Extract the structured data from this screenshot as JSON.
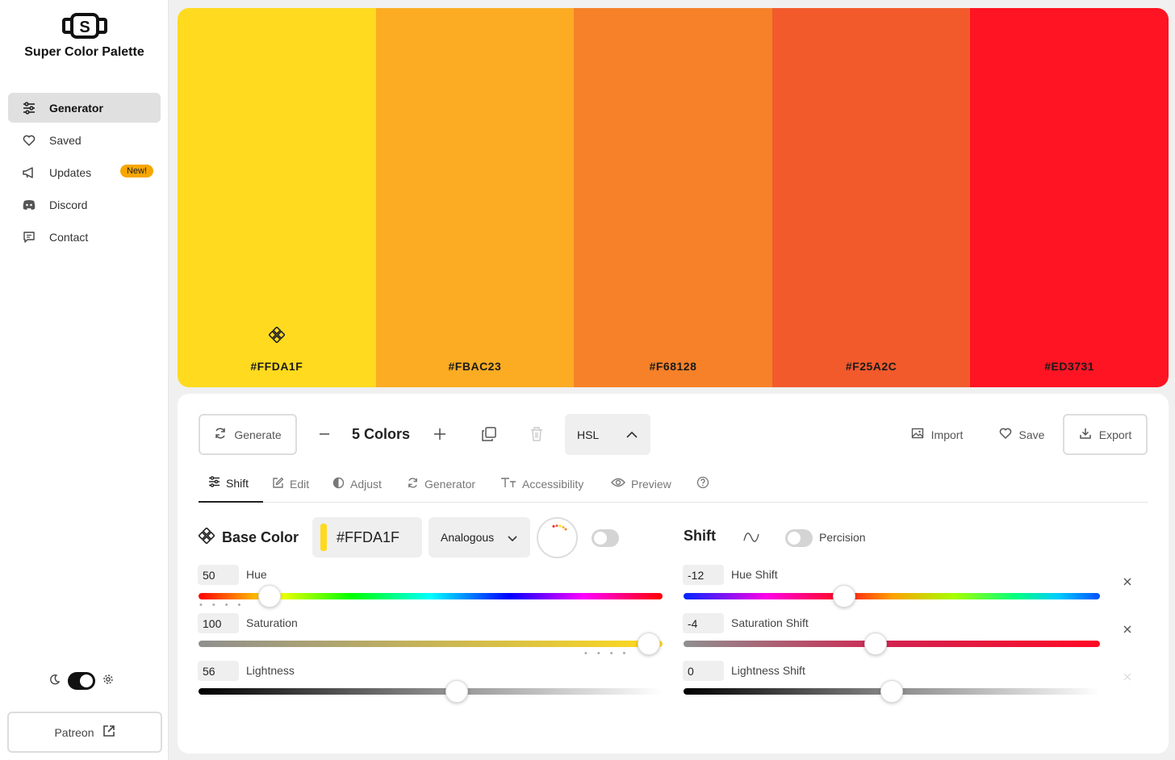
{
  "app": {
    "name": "Super Color Palette"
  },
  "sidebar": {
    "items": [
      {
        "label": "Generator",
        "icon": "sliders-icon",
        "active": true
      },
      {
        "label": "Saved",
        "icon": "heart-icon"
      },
      {
        "label": "Updates",
        "icon": "megaphone-icon",
        "badge": "New!"
      },
      {
        "label": "Discord",
        "icon": "discord-icon"
      },
      {
        "label": "Contact",
        "icon": "message-icon"
      }
    ],
    "patreon_label": "Patreon"
  },
  "palette": {
    "swatches": [
      {
        "hex": "#FFDA1F",
        "color": "#FFDA1F",
        "base": true
      },
      {
        "hex": "#FBAC23",
        "color": "#FBAC23"
      },
      {
        "hex": "#F68128",
        "color": "#F68128"
      },
      {
        "hex": "#F25A2C",
        "color": "#F25A2C"
      },
      {
        "hex": "#ED3731",
        "color": "#FF1423"
      }
    ]
  },
  "toolbar": {
    "generate_label": "Generate",
    "colors_label": "5 Colors",
    "mode_label": "HSL",
    "import_label": "Import",
    "save_label": "Save",
    "export_label": "Export"
  },
  "tabs": [
    {
      "label": "Shift",
      "active": true
    },
    {
      "label": "Edit"
    },
    {
      "label": "Adjust"
    },
    {
      "label": "Generator"
    },
    {
      "label": "Accessibility"
    },
    {
      "label": "Preview"
    }
  ],
  "base": {
    "title": "Base Color",
    "hex": "#FFDA1F",
    "harmony": "Analogous",
    "hue": {
      "value": "50",
      "label": "Hue",
      "fraction": 0.153
    },
    "saturation": {
      "value": "100",
      "label": "Saturation",
      "fraction": 0.97
    },
    "lightness": {
      "value": "56",
      "label": "Lightness",
      "fraction": 0.556
    }
  },
  "shift": {
    "title": "Shift",
    "precision_label": "Percision",
    "hue": {
      "value": "-12",
      "label": "Hue Shift",
      "fraction": 0.386
    },
    "saturation": {
      "value": "-4",
      "label": "Saturation Shift",
      "fraction": 0.462
    },
    "lightness": {
      "value": "0",
      "label": "Lightness Shift",
      "fraction": 0.5
    }
  },
  "colors": {
    "accent_badge": "#f7a600",
    "base": "#FFDA1F"
  }
}
